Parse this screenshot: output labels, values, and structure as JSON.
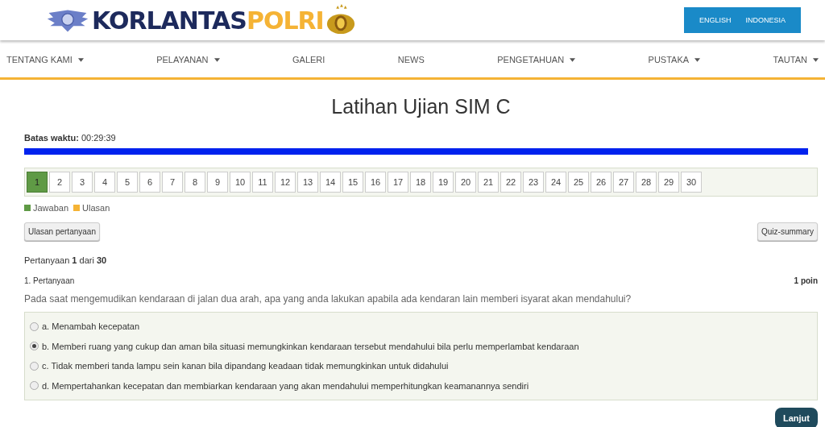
{
  "header": {
    "wordmark": {
      "primary": "KORLANTAS",
      "accent": "POLRI"
    },
    "languages": [
      {
        "label": "ENGLISH",
        "selected": false
      },
      {
        "label": "INDONESIA",
        "selected": false
      }
    ]
  },
  "nav": [
    {
      "label": "TENTANG KAMI",
      "dropdown": true
    },
    {
      "label": "PELAYANAN",
      "dropdown": true
    },
    {
      "label": "GALERI",
      "dropdown": false
    },
    {
      "label": "NEWS",
      "dropdown": false
    },
    {
      "label": "PENGETAHUAN",
      "dropdown": true
    },
    {
      "label": "PUSTAKA",
      "dropdown": true
    },
    {
      "label": "TAUTAN",
      "dropdown": true
    }
  ],
  "page_title": "Latihan Ujian SIM C",
  "timer": {
    "label": "Batas waktu:",
    "value": "00:29:39",
    "level": 1
  },
  "question_nav": [
    {
      "label": "1",
      "selected": true
    },
    {
      "label": "2",
      "selected": false
    },
    {
      "label": "3",
      "selected": false
    },
    {
      "label": "4",
      "selected": false
    },
    {
      "label": "5",
      "selected": false
    },
    {
      "label": "6",
      "selected": false
    },
    {
      "label": "7",
      "selected": false
    },
    {
      "label": "8",
      "selected": false
    },
    {
      "label": "9",
      "selected": false
    },
    {
      "label": "10",
      "selected": false
    },
    {
      "label": "11",
      "selected": false
    },
    {
      "label": "12",
      "selected": false
    },
    {
      "label": "13",
      "selected": false
    },
    {
      "label": "14",
      "selected": false
    },
    {
      "label": "15",
      "selected": false
    },
    {
      "label": "16",
      "selected": false
    },
    {
      "label": "17",
      "selected": false
    },
    {
      "label": "18",
      "selected": false
    },
    {
      "label": "19",
      "selected": false
    },
    {
      "label": "20",
      "selected": false
    },
    {
      "label": "21",
      "selected": false
    },
    {
      "label": "22",
      "selected": false
    },
    {
      "label": "23",
      "selected": false
    },
    {
      "label": "24",
      "selected": false
    },
    {
      "label": "25",
      "selected": false
    },
    {
      "label": "26",
      "selected": false
    },
    {
      "label": "27",
      "selected": false
    },
    {
      "label": "28",
      "selected": false
    },
    {
      "label": "29",
      "selected": false
    },
    {
      "label": "30",
      "selected": false
    }
  ],
  "legend": [
    {
      "label": "Jawaban",
      "color": "#5f9a45"
    },
    {
      "label": "Ulasan",
      "color": "#f5b335"
    }
  ],
  "buttons": {
    "review": "Ulasan pertanyaan",
    "summary": "Quiz-summary",
    "next": "Lanjut"
  },
  "progress": "Pertanyaan **1** dari **30**",
  "question": {
    "number": "1. Pertanyaan",
    "points": "1 poin",
    "text": "Pada saat mengemudikan kendaraan di jalan dua arah, apa yang anda lakukan apabila ada kendaran lain memberi isyarat akan mendahului?",
    "options": [
      {
        "label": "a. Menambah kecepatan",
        "selected": false
      },
      {
        "label": "b. Memberi ruang yang cukup dan aman bila situasi memungkinkan kendaraan tersebut mendahului bila perlu memperlambat kendaraan",
        "selected": true
      },
      {
        "label": "c. Tidak memberi tanda lampu sein kanan bila dipandang keadaan tidak memungkinkan untuk didahului",
        "selected": false
      },
      {
        "label": "d. Mempertahankan kecepatan dan membiarkan kendaraan yang akan mendahului memperhitungkan keamanannya sendiri",
        "selected": false
      }
    ]
  }
}
